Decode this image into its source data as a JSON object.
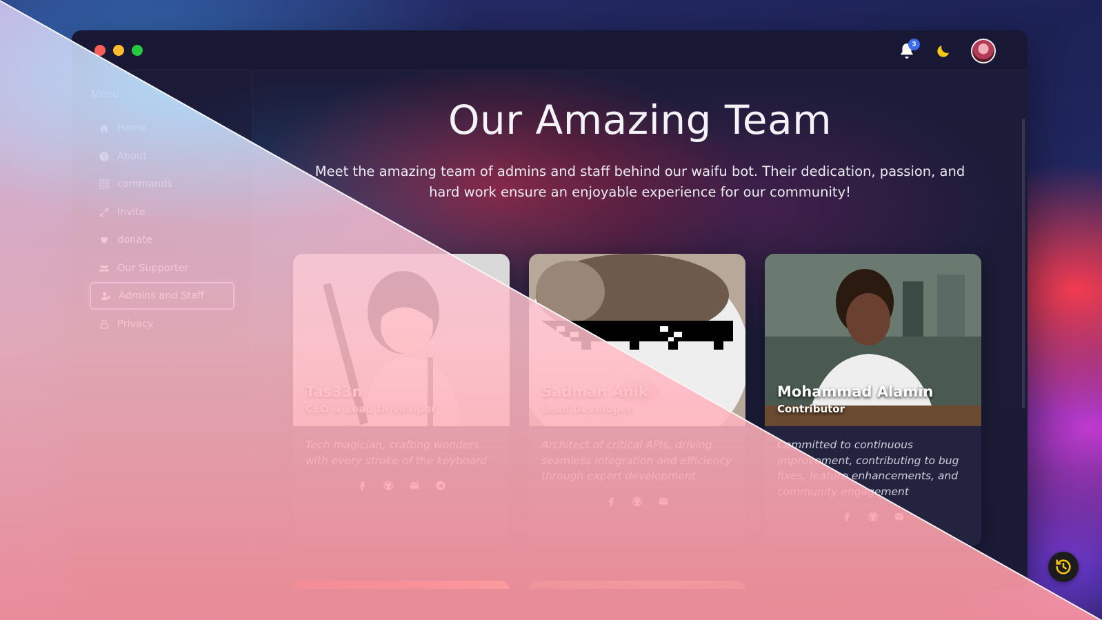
{
  "colors": {
    "accent": "#a7a8f5",
    "badge": "#3a6cf0",
    "moon": "#f5c518",
    "traffic_red": "#ff5f57",
    "traffic_yellow": "#febc2e",
    "traffic_green": "#28c840"
  },
  "topbar": {
    "notifications_count": "3",
    "bell_icon": "bell-icon",
    "theme_icon": "moon-icon",
    "avatar": "user-avatar"
  },
  "sidebar": {
    "title": "Menu",
    "items": [
      {
        "label": "Home",
        "icon": "home-icon"
      },
      {
        "label": "About",
        "icon": "info-icon"
      },
      {
        "label": "commands",
        "icon": "grid-icon"
      },
      {
        "label": "Invite",
        "icon": "expand-arrows-icon"
      },
      {
        "label": "donate",
        "icon": "donate-heart-icon"
      },
      {
        "label": "Our Supporter",
        "icon": "people-icon"
      },
      {
        "label": "Admins and Staff",
        "icon": "user-tie-icon",
        "active": true
      },
      {
        "label": "Privacy",
        "icon": "lock-icon"
      }
    ]
  },
  "main": {
    "title": "Our Amazing Team",
    "subtitle": "Meet the amazing team of admins and staff behind our waifu bot. Their dedication, passion, and hard work ensure an enjoyable experience for our community!",
    "cards": [
      {
        "name": "Tas33n",
        "role": "CEO & Lead Developer",
        "description": "Tech magician, crafting wonders with every stroke of the keyboard",
        "social": [
          "facebook-icon",
          "github-icon",
          "email-icon",
          "telegram-icon"
        ]
      },
      {
        "name": "Sadman Anik",
        "role": "Lead Developer",
        "description": "Architect of critical APIs, driving seamless integration and efficiency through expert development",
        "social": [
          "facebook-icon",
          "github-icon",
          "email-icon"
        ]
      },
      {
        "name": "Mohammad Alamin",
        "role": "Contributor",
        "description": "Committed to continuous improvement, contributing to bug fixes, feature enhancements, and community engagement",
        "social": [
          "facebook-icon",
          "github-icon",
          "email-icon"
        ]
      }
    ]
  },
  "restore_icon": "history-icon"
}
